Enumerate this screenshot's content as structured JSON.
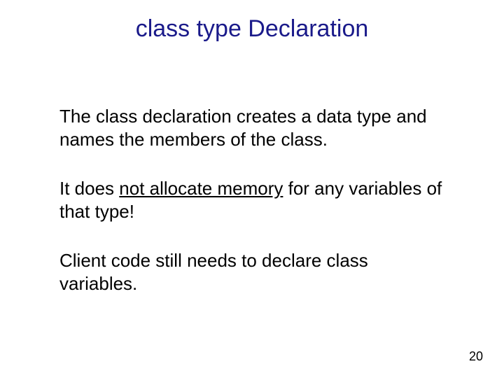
{
  "title": "class type Declaration",
  "paragraphs": {
    "p1": "The class declaration creates a data type and names the members of the class.",
    "p2_pre": "It does ",
    "p2_underlined": "not allocate memory",
    "p2_post": " for any variables of that type!",
    "p3": "Client code still needs to declare class variables."
  },
  "page_number": "20"
}
